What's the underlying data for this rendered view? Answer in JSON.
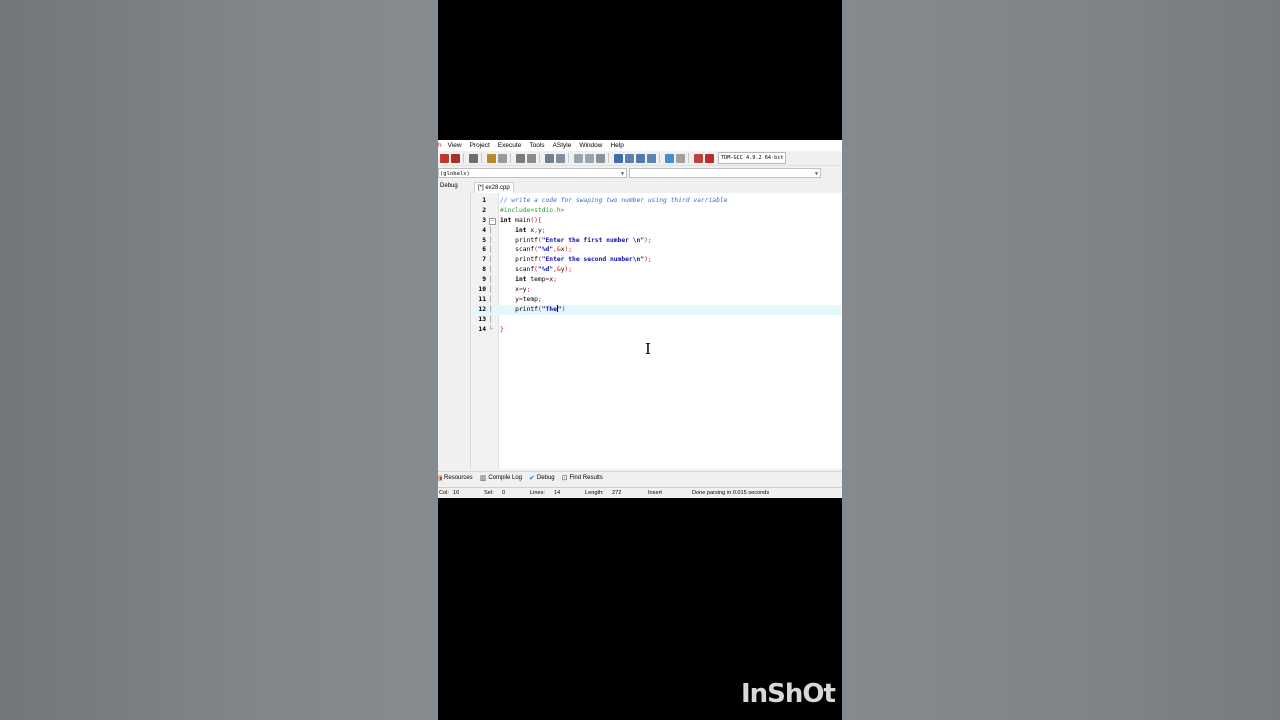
{
  "menu": {
    "items": [
      "View",
      "Project",
      "Execute",
      "Tools",
      "AStyle",
      "Window",
      "Help"
    ]
  },
  "toolbar": {
    "compiler": "TDM-GCC 4.9.2 64-bit"
  },
  "selectors": {
    "scope": "(globals)",
    "member": ""
  },
  "left_tab": "Debug",
  "file_tab": "[*] ex28.cpp",
  "code_lines": [
    {
      "n": "1",
      "segs": [
        [
          "// write a code for swaping two number using third varriable",
          "comment"
        ]
      ]
    },
    {
      "n": "2",
      "segs": [
        [
          "#include<stdio.h>",
          "pre"
        ]
      ]
    },
    {
      "n": "3",
      "segs": [
        [
          "int",
          "kw"
        ],
        [
          " main",
          "plain"
        ],
        [
          "(){",
          "punc"
        ]
      ]
    },
    {
      "n": "4",
      "segs": [
        [
          "    ",
          "plain"
        ],
        [
          "int",
          "kw"
        ],
        [
          " x",
          "plain"
        ],
        [
          ",",
          "punc"
        ],
        [
          "y",
          "plain"
        ],
        [
          ";",
          "punc"
        ]
      ]
    },
    {
      "n": "5",
      "segs": [
        [
          "    printf",
          "plain"
        ],
        [
          "(",
          "punc"
        ],
        [
          "\"Enter the first number \\n\"",
          "str"
        ],
        [
          ");",
          "punc"
        ]
      ]
    },
    {
      "n": "6",
      "segs": [
        [
          "    scanf",
          "plain"
        ],
        [
          "(",
          "punc"
        ],
        [
          "\"%d\"",
          "str"
        ],
        [
          ",&",
          "punc"
        ],
        [
          "x",
          "plain"
        ],
        [
          ");",
          "punc"
        ]
      ]
    },
    {
      "n": "7",
      "segs": [
        [
          "    printf",
          "plain"
        ],
        [
          "(",
          "punc"
        ],
        [
          "\"Enter the second number\\n\"",
          "str"
        ],
        [
          ");",
          "punc"
        ]
      ]
    },
    {
      "n": "8",
      "segs": [
        [
          "    scanf",
          "plain"
        ],
        [
          "(",
          "punc"
        ],
        [
          "\"%d\"",
          "str"
        ],
        [
          ",&",
          "punc"
        ],
        [
          "y",
          "plain"
        ],
        [
          ");",
          "punc"
        ]
      ]
    },
    {
      "n": "9",
      "segs": [
        [
          "    ",
          "plain"
        ],
        [
          "int",
          "kw"
        ],
        [
          " temp",
          "plain"
        ],
        [
          "=",
          "punc"
        ],
        [
          "x",
          "plain"
        ],
        [
          ";",
          "punc"
        ]
      ]
    },
    {
      "n": "10",
      "segs": [
        [
          "    x",
          "plain"
        ],
        [
          "=",
          "punc"
        ],
        [
          "y",
          "plain"
        ],
        [
          ";",
          "punc"
        ]
      ]
    },
    {
      "n": "11",
      "segs": [
        [
          "    y",
          "plain"
        ],
        [
          "=",
          "punc"
        ],
        [
          "temp",
          "plain"
        ],
        [
          ";",
          "punc"
        ]
      ]
    },
    {
      "n": "12",
      "segs": [
        [
          "    printf",
          "plain"
        ],
        [
          "(",
          "punc"
        ],
        [
          "\"The",
          "str"
        ],
        [
          "|caret|",
          "caret"
        ],
        [
          "\"",
          "str"
        ],
        [
          ")",
          "punc"
        ]
      ]
    },
    {
      "n": "13",
      "segs": []
    },
    {
      "n": "14",
      "segs": [
        [
          "}",
          "punc"
        ]
      ]
    }
  ],
  "active_line": 12,
  "bottom_tabs": [
    {
      "label": "Resources",
      "icon": "resources-icon"
    },
    {
      "label": "Compile Log",
      "icon": "compile-log-icon"
    },
    {
      "label": "Debug",
      "icon": "debug-icon"
    },
    {
      "label": "Find Results",
      "icon": "find-results-icon"
    }
  ],
  "status": {
    "col_label": "Col:",
    "col": "16",
    "sel_label": "Sel:",
    "sel": "0",
    "lines_label": "Lines:",
    "lines": "14",
    "length_label": "Length:",
    "length": "272",
    "mode": "Insert",
    "message": "Done parsing in 0.015 seconds"
  },
  "watermark": "InShOt",
  "colors": {
    "comment": "#2f6fd6",
    "preprocessor": "#20a030",
    "string": "#1010b0",
    "symbol": "#c01010",
    "active_line": "#e4f7fb"
  }
}
